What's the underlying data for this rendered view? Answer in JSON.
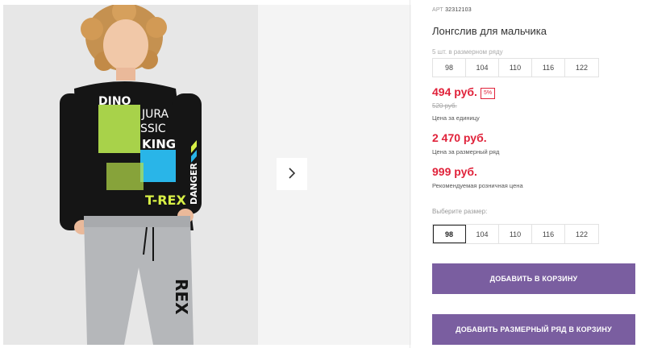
{
  "colors": {
    "accent": "#7a5ea0",
    "price": "#e0223a"
  },
  "gallery": {
    "next_icon": "chevron-right-icon"
  },
  "product": {
    "art_label": "АРТ",
    "art_number": "32312103",
    "title": "Лонгслив для мальчика",
    "size_row_label": "5 шт. в размерном ряду",
    "size_row": [
      "98",
      "104",
      "110",
      "116",
      "122"
    ],
    "price": "494 руб.",
    "discount": "5%",
    "old_price": "520 руб.",
    "price_note": "Цена за единицу",
    "row_price": "2 470 руб.",
    "row_price_note": "Цена за размерный ряд",
    "retail_price": "999 руб.",
    "retail_price_note": "Рекомендуемая розничная цена",
    "choose_label": "Выберите размер:",
    "sizes": [
      "98",
      "104",
      "110",
      "116",
      "122"
    ],
    "selected_size": "98",
    "add_to_cart": "ДОБАВИТЬ В КОРЗИНУ",
    "add_row_to_cart": "ДОБАВИТЬ РАЗМЕРНЫЙ РЯД В КОРЗИНУ"
  }
}
